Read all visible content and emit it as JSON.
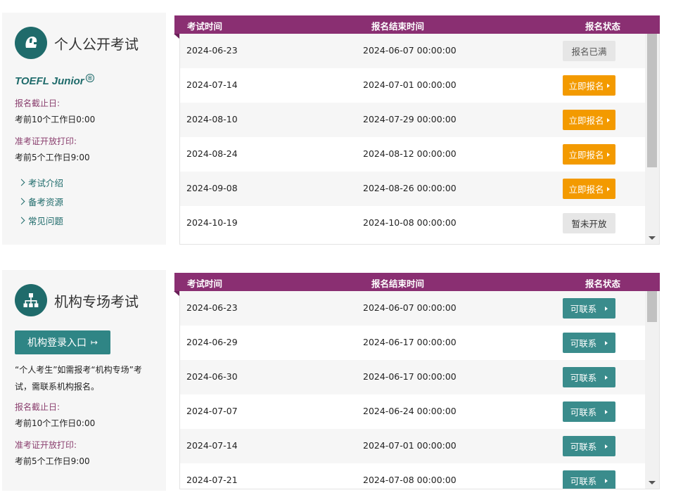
{
  "public": {
    "title": "个人公开考试",
    "brand": "TOEFL Junior",
    "brand_mark": "®",
    "deadline_label": "报名截止日:",
    "deadline_value": "考前10个工作日0:00",
    "print_label": "准考证开放打印:",
    "print_value": "考前5个工作日9:00",
    "links": [
      "考试介绍",
      "备考资源",
      "常见问题"
    ],
    "headers": [
      "考试时间",
      "报名结束时间",
      "报名状态"
    ],
    "rows": [
      {
        "date": "2024-06-23",
        "end": "2024-06-07 00:00:00",
        "status": "报名已满",
        "type": "full"
      },
      {
        "date": "2024-07-14",
        "end": "2024-07-01 00:00:00",
        "status": "立即报名",
        "type": "open"
      },
      {
        "date": "2024-08-10",
        "end": "2024-07-29 00:00:00",
        "status": "立即报名",
        "type": "open"
      },
      {
        "date": "2024-08-24",
        "end": "2024-08-12 00:00:00",
        "status": "立即报名",
        "type": "open"
      },
      {
        "date": "2024-09-08",
        "end": "2024-08-26 00:00:00",
        "status": "立即报名",
        "type": "open"
      },
      {
        "date": "2024-10-19",
        "end": "2024-10-08 00:00:00",
        "status": "暂未开放",
        "type": "closed"
      }
    ]
  },
  "institution": {
    "title": "机构专场考试",
    "login_label": "机构登录入口",
    "note": "“个人考生”如需报考“机构专场”考试，需联系机构报名。",
    "deadline_label": "报名截止日:",
    "deadline_value": "考前10个工作日0:00",
    "print_label": "准考证开放打印:",
    "print_value": "考前5个工作日9:00",
    "headers": [
      "考试时间",
      "报名结束时间",
      "报名状态"
    ],
    "rows": [
      {
        "date": "2024-06-23",
        "end": "2024-06-07 00:00:00",
        "status": "可联系",
        "type": "contact"
      },
      {
        "date": "2024-06-29",
        "end": "2024-06-17 00:00:00",
        "status": "可联系",
        "type": "contact"
      },
      {
        "date": "2024-06-30",
        "end": "2024-06-17 00:00:00",
        "status": "可联系",
        "type": "contact"
      },
      {
        "date": "2024-07-07",
        "end": "2024-06-24 00:00:00",
        "status": "可联系",
        "type": "contact"
      },
      {
        "date": "2024-07-14",
        "end": "2024-07-01 00:00:00",
        "status": "可联系",
        "type": "contact"
      },
      {
        "date": "2024-07-21",
        "end": "2024-07-08 00:00:00",
        "status": "可联系",
        "type": "contact"
      }
    ]
  },
  "colors": {
    "teal": "#1f6b6b",
    "header_purple": "#8a2f72",
    "open_orange": "#f39a00",
    "contact_teal": "#3a8c8c"
  },
  "icons": {
    "public": "helmet-icon",
    "institution": "org-chart-icon"
  }
}
